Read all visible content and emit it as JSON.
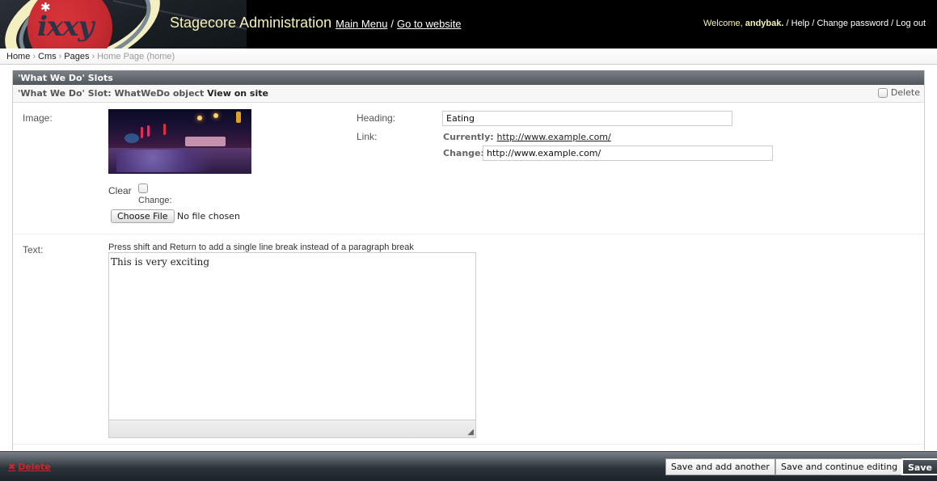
{
  "header": {
    "logo_text": "ixxy",
    "site_title": "Stagecore Administration",
    "main_menu": "Main Menu",
    "go_to_website": "Go to website",
    "separator": "/",
    "welcome": "Welcome,",
    "username": "andybak.",
    "help": "Help",
    "change_password": "Change password",
    "log_out": "Log out"
  },
  "breadcrumbs": [
    {
      "label": "Home",
      "link": true
    },
    {
      "label": "Cms",
      "link": true
    },
    {
      "label": "Pages",
      "link": true
    },
    {
      "label": "Home Page (home)",
      "link": false
    }
  ],
  "breadcrumb_separator": "›",
  "module": {
    "title": "'What We Do' Slots",
    "object_title": "'What We Do' Slot: WhatWeDo object",
    "view_on_site": "View on site",
    "delete_label": "Delete",
    "delete_checked": false
  },
  "form": {
    "image": {
      "label": "Image:",
      "clear_label": "Clear",
      "clear_checked": false,
      "change_label": "Change:",
      "choose_file": "Choose File",
      "no_file": "No file chosen"
    },
    "heading": {
      "label": "Heading:",
      "value": "Eating"
    },
    "link": {
      "label": "Link:",
      "currently_label": "Currently:",
      "currently_value": "http://www.example.com/",
      "change_label": "Change:",
      "value": "http://www.example.com/"
    },
    "text": {
      "label": "Text:",
      "help": "Press shift and Return to add a single line break instead of a paragraph break",
      "value": "This is very exciting"
    }
  },
  "submit_row": {
    "delete": "Delete",
    "save_add_another": "Save and add another",
    "save_continue": "Save and continue editing",
    "save": "Save"
  },
  "colors": {
    "header_bg": "#000000",
    "title_color": "#f6f1b8",
    "delete_red": "#d2232a",
    "module_header": "#5a6167"
  }
}
